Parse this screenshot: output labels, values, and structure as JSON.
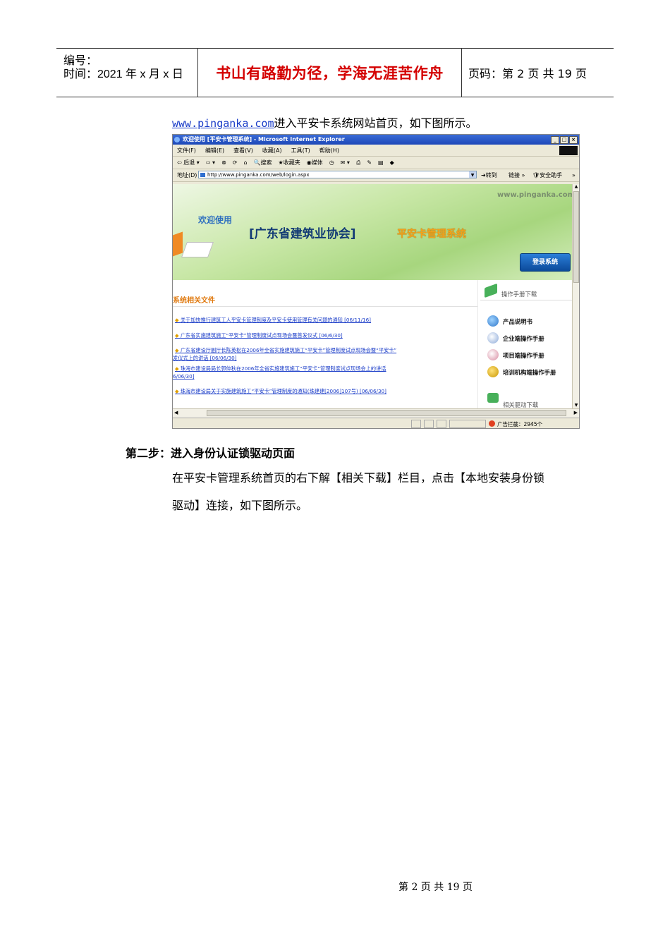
{
  "header": {
    "number_label": "编号：",
    "time_label": "时间：2021 年 x 月 x 日",
    "motto": "书山有路勤为径，学海无涯苦作舟",
    "page_info": "页码：第 2 页  共 19 页"
  },
  "intro": {
    "link": "www.pinganka.com",
    "text": "进入平安卡系统网站首页，如下图所示。"
  },
  "browser": {
    "title": "欢迎使用 [平安卡管理系统] - Microsoft Internet Explorer",
    "menu": [
      "文件(F)",
      "编辑(E)",
      "查看(V)",
      "收藏(A)",
      "工具(T)",
      "帮助(H)"
    ],
    "toolbar": {
      "back": "后退",
      "search": "搜索",
      "favorites": "收藏夹",
      "media": "媒体"
    },
    "address_label": "地址(D)",
    "address": "http://www.pinganka.com/web/login.aspx",
    "go": "转到",
    "links": "链接",
    "assistant": "安全助手",
    "status_popup": "广告拦截：2945个"
  },
  "site": {
    "domain": "www.pinganka.com",
    "welcome": "欢迎使用",
    "org": "[广东省建筑业协会]",
    "system": "平安卡管理系统",
    "login_button": "登录系统",
    "docs_heading": "系统相关文件",
    "news": [
      "关于加快推行建筑工人平安卡管理制度及平安卡使用管理有关问题的通知 [06/11/16]",
      "广东省实施建筑施工“平安卡”管理制度试点现场会暨首发仪式 [06/6/30]",
      "广东省建设厅副厅长陈英松在2006年全省实施建筑施工“平安卡”管理制度试点现场会暨“平安卡”",
      "发仪式上的讲话 [06/06/30]",
      "珠海市建设局局长郭仲秋在2006年全省实施建筑施工“平安卡”管理制度试点现场会上的讲话",
      "6/06/30]",
      "珠海市建设局关于实施建筑施工“平安卡”管理制度的通知(珠建建[2006]107号) [06/06/30]"
    ],
    "manual_heading": "操作手册下载",
    "manuals": [
      "产品说明书",
      "企业端操作手册",
      "项目端操作手册",
      "培训机构端操作手册"
    ],
    "driver_heading": "相关驱动下载"
  },
  "step2": {
    "heading": "第二步：进入身份认证锁驱动页面",
    "line1": "在平安卡管理系统首页的右下解【相关下载】栏目，点击【本地安装身份锁",
    "line2": "驱动】连接，如下图所示。"
  },
  "footer": {
    "page": "第  2  页  共  19  页"
  }
}
